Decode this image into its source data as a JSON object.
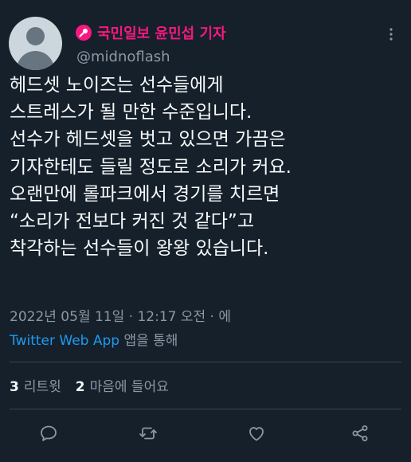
{
  "author": {
    "display_name": "국민일보 윤민섭 기자",
    "handle": "@midnoflash",
    "badge_icon": "microphone-icon",
    "name_color": "#f91880"
  },
  "tweet": {
    "lines": [
      "헤드셋 노이즈는 선수들에게",
      "스트레스가 될 만한 수준입니다.",
      "선수가 헤드셋을 벗고 있으면 가끔은",
      "기자한테도 들릴 정도로 소리가 커요.",
      "오랜만에 롤파크에서 경기를 치르면",
      "“소리가 전보다 커진 것 같다”고",
      "착각하는 선수들이 왕왕 있습니다."
    ]
  },
  "meta": {
    "time": "2022년 05월 11일 · 12:17 오전 · 에",
    "source_app": "Twitter Web App",
    "source_suffix": " 앱을 통해"
  },
  "stats": {
    "retweets_count": "3",
    "retweets_label": "리트윗",
    "likes_count": "2",
    "likes_label": "마음에 들어요"
  },
  "actions": [
    "reply-icon",
    "retweet-icon",
    "like-icon",
    "share-icon"
  ],
  "colors": {
    "background": "#15202b",
    "text": "#f7f9f9",
    "secondary": "#8b98a5",
    "link": "#1d9bf0",
    "divider": "#38444d"
  }
}
